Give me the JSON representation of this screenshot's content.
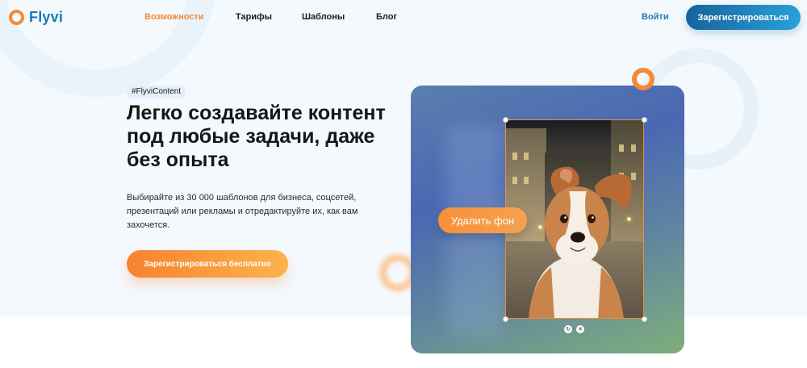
{
  "brand": {
    "name": "Flyvi"
  },
  "nav": {
    "items": [
      {
        "label": "Возможности",
        "active": true
      },
      {
        "label": "Тарифы",
        "active": false
      },
      {
        "label": "Шаблоны",
        "active": false
      },
      {
        "label": "Блог",
        "active": false
      }
    ],
    "login": "Войти",
    "signup": "Зарегистрироваться"
  },
  "hero": {
    "tag": "#FlyviContent",
    "title": "Легко создавайте контент под любые задачи, даже без опыта",
    "description": "Выбирайте из 30 000 шаблонов для бизнеса, соцсетей, презентаций или рекламы и отредактируйте их, как вам захочется.",
    "cta": "Зарегистрироваться бесплатно"
  },
  "editor": {
    "remove_bg": "Удалить фон",
    "controls": [
      {
        "icon": "rotate-icon",
        "glyph": "↻"
      },
      {
        "icon": "delete-icon",
        "glyph": "✕"
      }
    ]
  },
  "colors": {
    "accent_orange": "#f58a36",
    "brand_blue": "#1c78b8",
    "hero_bg": "#f4f9fd"
  }
}
